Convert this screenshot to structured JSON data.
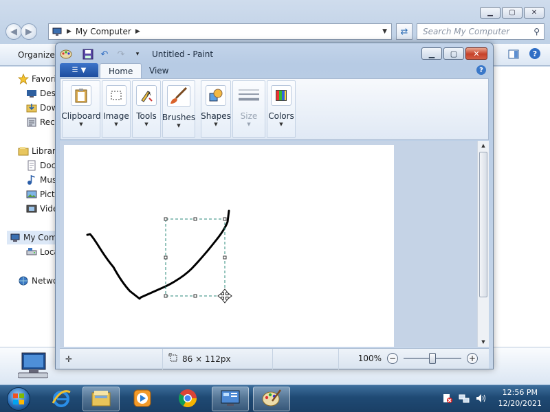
{
  "explorer": {
    "address_label": "My Computer",
    "search_placeholder": "Search My Computer",
    "toolbar_organize": "Organize",
    "nav": {
      "favorites": "Favorites",
      "desktop": "Desktop",
      "downloads": "Downloads",
      "recent": "Recent Places",
      "libraries": "Libraries",
      "documents": "Documents",
      "music": "Music",
      "pictures": "Pictures",
      "videos": "Videos",
      "computer": "My Computer",
      "local_disk": "Local Disk (C:)",
      "network": "Network"
    }
  },
  "paint": {
    "title": "Untitled - Paint",
    "tabs": {
      "home": "Home",
      "view": "View"
    },
    "groups": {
      "clipboard": "Clipboard",
      "image": "Image",
      "tools": "Tools",
      "brushes": "Brushes",
      "shapes": "Shapes",
      "size": "Size",
      "colors": "Colors"
    },
    "status": {
      "selection_size": "86 × 112px",
      "zoom": "100%",
      "zoom_level": 0.5
    }
  },
  "taskbar": {
    "time": "12:56 PM",
    "date": "12/20/2021"
  }
}
